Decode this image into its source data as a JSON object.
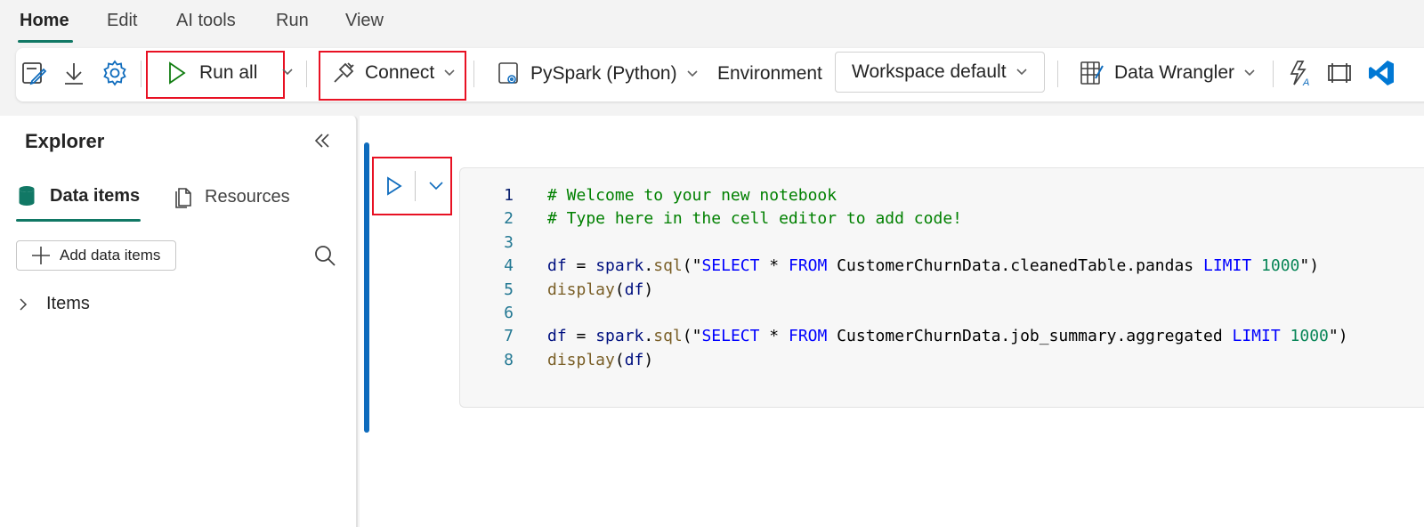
{
  "menu": {
    "tabs": [
      "Home",
      "Edit",
      "AI tools",
      "Run",
      "View"
    ],
    "active": "Home"
  },
  "toolbar": {
    "run_all_label": "Run all",
    "connect_label": "Connect",
    "language_label": "PySpark (Python)",
    "environment_label": "Environment",
    "workspace_label": "Workspace default",
    "data_wrangler_label": "Data Wrangler",
    "icons": [
      "edit-notebook-icon",
      "download-icon",
      "settings-icon",
      "run-icon",
      "connect-plug-icon",
      "language-settings-icon",
      "data-wrangler-icon",
      "copilot-formula-icon",
      "frame-icon",
      "vscode-icon"
    ]
  },
  "explorer": {
    "title": "Explorer",
    "tabs": [
      "Data items",
      "Resources"
    ],
    "active_tab": "Data items",
    "add_button_label": "Add data items",
    "tree_items": [
      "Items"
    ]
  },
  "cell": {
    "lines": [
      {
        "n": "1",
        "tokens": [
          [
            "com",
            "# Welcome to your new notebook"
          ]
        ]
      },
      {
        "n": "2",
        "tokens": [
          [
            "com",
            "# Type here in the cell editor to add code!"
          ]
        ]
      },
      {
        "n": "3",
        "tokens": []
      },
      {
        "n": "4",
        "tokens": [
          [
            "var",
            "df"
          ],
          [
            "pl",
            " = "
          ],
          [
            "var",
            "spark"
          ],
          [
            "pl",
            "."
          ],
          [
            "fn",
            "sql"
          ],
          [
            "pl",
            "(\""
          ],
          [
            "kw",
            "SELECT"
          ],
          [
            "pl",
            " * "
          ],
          [
            "kw",
            "FROM"
          ],
          [
            "pl",
            " CustomerChurnData.cleanedTable.pandas "
          ],
          [
            "kw",
            "LIMIT"
          ],
          [
            "pl",
            " "
          ],
          [
            "num",
            "1000"
          ],
          [
            "pl",
            "\")"
          ]
        ]
      },
      {
        "n": "5",
        "tokens": [
          [
            "fn",
            "display"
          ],
          [
            "pl",
            "("
          ],
          [
            "var",
            "df"
          ],
          [
            "pl",
            ")"
          ]
        ]
      },
      {
        "n": "6",
        "tokens": []
      },
      {
        "n": "7",
        "tokens": [
          [
            "var",
            "df"
          ],
          [
            "pl",
            " = "
          ],
          [
            "var",
            "spark"
          ],
          [
            "pl",
            "."
          ],
          [
            "fn",
            "sql"
          ],
          [
            "pl",
            "(\""
          ],
          [
            "kw",
            "SELECT"
          ],
          [
            "pl",
            " * "
          ],
          [
            "kw",
            "FROM"
          ],
          [
            "pl",
            " CustomerChurnData.job_summary.aggregated "
          ],
          [
            "kw",
            "LIMIT"
          ],
          [
            "pl",
            " "
          ],
          [
            "num",
            "1000"
          ],
          [
            "pl",
            "\")"
          ]
        ]
      },
      {
        "n": "8",
        "tokens": [
          [
            "fn",
            "display"
          ],
          [
            "pl",
            "("
          ],
          [
            "var",
            "df"
          ],
          [
            "pl",
            ")"
          ]
        ]
      }
    ]
  },
  "colors": {
    "accent": "#117865",
    "highlight": "#e81123",
    "cell_bar": "#0f6cbd"
  }
}
